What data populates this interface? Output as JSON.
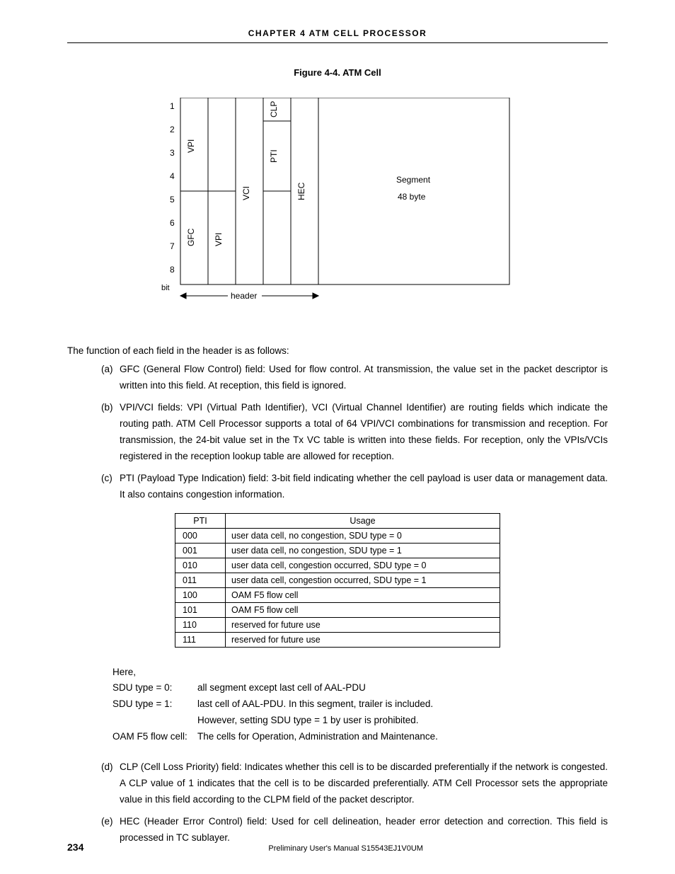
{
  "header": {
    "chapter": "CHAPTER  4   ATM  CELL  PROCESSOR"
  },
  "figure": {
    "title": "Figure 4-4.  ATM Cell",
    "bits": [
      "1",
      "2",
      "3",
      "4",
      "5",
      "6",
      "7",
      "8"
    ],
    "bit_label": "bit",
    "labels": {
      "gfc": "GFC",
      "vpi1": "VPI",
      "vpi2": "VPI",
      "vci": "VCI",
      "pti": "PTI",
      "clp": "CLP",
      "hec": "HEC",
      "segment1": "Segment",
      "segment2": "48 byte",
      "header_arrow": "header"
    }
  },
  "intro": "The function of each field in the header is as follows:",
  "fields": {
    "a": {
      "marker": "(a)",
      "text": "GFC (General Flow Control) field: Used for flow control. At transmission, the value set in the packet descriptor is written into this field. At reception, this field is ignored."
    },
    "b": {
      "marker": "(b)",
      "text": "VPI/VCI fields: VPI (Virtual Path Identifier), VCI (Virtual Channel Identifier) are routing fields which indicate the routing path. ATM Cell Processor supports a total of 64 VPI/VCI combinations for transmission and reception. For transmission, the 24-bit value set in the Tx VC table is written into these fields.  For reception, only the VPIs/VCIs registered in the reception lookup table are allowed for reception."
    },
    "c": {
      "marker": "(c)",
      "text": "PTI (Payload Type Indication) field: 3-bit field indicating whether the cell payload is user data or management data. It also contains congestion information."
    },
    "d": {
      "marker": "(d)",
      "text": "CLP (Cell Loss Priority) field: Indicates whether this cell is to be discarded preferentially if the network is congested. A CLP value of 1 indicates that the cell is to be discarded preferentially. ATM Cell Processor sets the appropriate value in this field according to the CLPM field of the packet descriptor."
    },
    "e": {
      "marker": "(e)",
      "text": "HEC (Header Error Control) field: Used for cell delineation, header error detection and correction. This field is processed in TC sublayer."
    }
  },
  "pti_table": {
    "head": {
      "pti": "PTI",
      "usage": "Usage"
    },
    "rows": [
      {
        "pti": "000",
        "usage": "user data cell, no congestion, SDU type = 0"
      },
      {
        "pti": "001",
        "usage": "user data cell, no congestion, SDU type = 1"
      },
      {
        "pti": "010",
        "usage": "user data cell, congestion occurred, SDU type = 0"
      },
      {
        "pti": "011",
        "usage": "user data cell, congestion occurred, SDU type = 1"
      },
      {
        "pti": "100",
        "usage": "OAM F5 flow cell"
      },
      {
        "pti": "101",
        "usage": "OAM F5 flow cell"
      },
      {
        "pti": "110",
        "usage": "reserved for future use"
      },
      {
        "pti": "111",
        "usage": "reserved for future use"
      }
    ]
  },
  "defs": {
    "here": "Here,",
    "rows": [
      {
        "label": "SDU type = 0:",
        "value": "all segment except last cell of AAL-PDU"
      },
      {
        "label": "SDU type = 1:",
        "value": "last cell of AAL-PDU. In this segment, trailer is included."
      },
      {
        "label": "",
        "value": "However, setting SDU type = 1 by user is prohibited."
      },
      {
        "label": "OAM F5 flow cell:",
        "value": "The cells for Operation, Administration and Maintenance."
      }
    ]
  },
  "footer": {
    "page": "234",
    "text": "Preliminary User's Manual  S15543EJ1V0UM"
  }
}
